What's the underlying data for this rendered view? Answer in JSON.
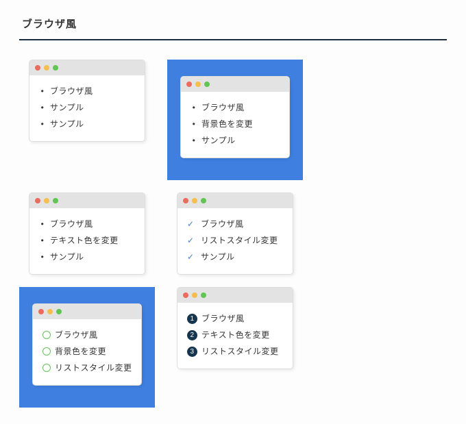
{
  "heading": "ブラウザ風",
  "cards": [
    {
      "bg": false,
      "marker": "bullet",
      "items": [
        "ブラウザ風",
        "サンプル",
        "サンプル"
      ]
    },
    {
      "bg": true,
      "marker": "bullet",
      "items": [
        "ブラウザ風",
        "背景色を変更",
        "サンプル"
      ]
    },
    {
      "bg": false,
      "marker": "bullet",
      "items": [
        "ブラウザ風",
        "テキスト色を変更",
        "サンプル"
      ]
    },
    {
      "bg": false,
      "marker": "check",
      "items": [
        "ブラウザ風",
        "リストスタイル変更",
        "サンプル"
      ]
    },
    {
      "bg": true,
      "marker": "circ",
      "items": [
        "ブラウザ風",
        "背景色を変更",
        "リストスタイル変更"
      ]
    },
    {
      "bg": false,
      "marker": "num",
      "items": [
        "ブラウザ風",
        "テキスト色を変更",
        "リストスタイル変更"
      ]
    }
  ]
}
